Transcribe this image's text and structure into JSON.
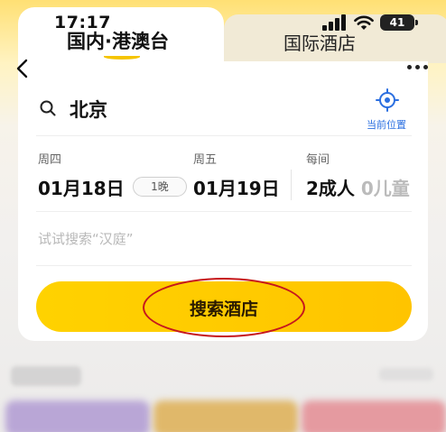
{
  "status_bar": {
    "time": "17:17",
    "battery": "41"
  },
  "tabs": [
    {
      "label": "国内·港澳台",
      "active": true
    },
    {
      "label": "国际酒店",
      "active": false
    }
  ],
  "search": {
    "city": "北京",
    "location_label": "当前位置"
  },
  "dates": {
    "checkin_weekday": "周四",
    "checkin_date": "01月18日",
    "nights": "1晚",
    "checkout_weekday": "周五",
    "checkout_date": "01月19日"
  },
  "guests": {
    "label": "每间",
    "adults": "2成人",
    "children": "0儿童"
  },
  "keyword_placeholder": "试试搜索“汉庭”",
  "search_button_label": "搜索酒店",
  "colors": {
    "accent": "#ffc400",
    "link": "#2b6fe0",
    "annotation": "#c6171d"
  }
}
